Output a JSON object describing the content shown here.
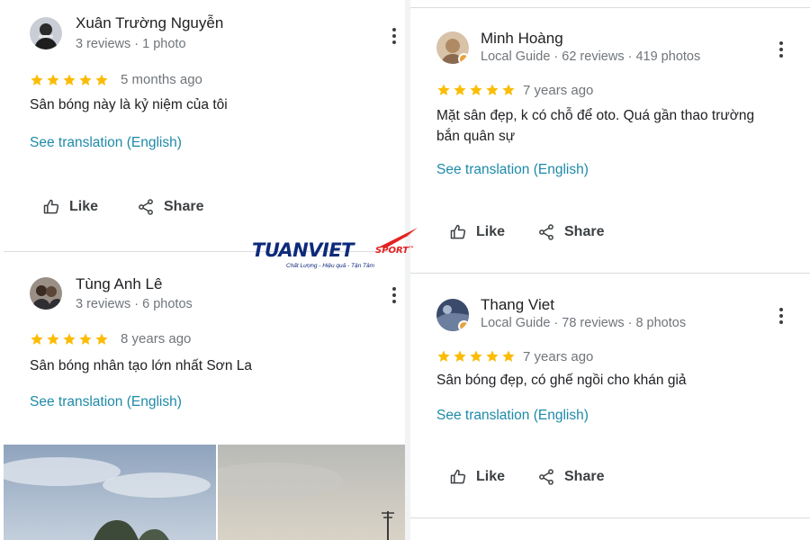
{
  "colors": {
    "star": "#fbbc04",
    "link": "#1e8aa8",
    "meta": "#70757a"
  },
  "icons": {
    "like": "thumbs-up-icon",
    "share": "share-icon",
    "more": "more-vert-icon",
    "star": "star-icon"
  },
  "reviews": [
    {
      "name": "Xuân Trường Nguyễn",
      "meta": "3 reviews · 1 photo",
      "rating": 5,
      "time": "5 months ago",
      "text": "Sân bóng này là kỷ niệm của tôi",
      "translate": "See translation (English)",
      "like": "Like",
      "share": "Share"
    },
    {
      "name": "Tùng Anh Lê",
      "meta": "3 reviews · 6 photos",
      "rating": 5,
      "time": "8 years ago",
      "text": "Sân bóng nhân tạo lớn nhất Sơn La",
      "translate": "See translation (English)"
    },
    {
      "name": "Minh Hoàng",
      "meta": "Local Guide · 62 reviews · 419 photos",
      "rating": 5,
      "time": "7 years ago",
      "text_line1": "Mặt sân đẹp, k có chỗ để oto. Quá gần thao trường",
      "text_line2": "bắn quân sự",
      "translate": "See translation (English)",
      "like": "Like",
      "share": "Share"
    },
    {
      "name": "Thang Viet",
      "meta": "Local Guide · 78 reviews · 8 photos",
      "rating": 5,
      "time": "7 years ago",
      "text": "Sân bóng đẹp, có ghế ngồi cho khán giả",
      "translate": "See translation (English)",
      "like": "Like",
      "share": "Share"
    }
  ],
  "watermark": {
    "brand": "TUANVIET",
    "sport": "SPORT",
    "tm": "™",
    "tagline": "Chất Lượng - Hiệu quả - Tận Tâm"
  }
}
